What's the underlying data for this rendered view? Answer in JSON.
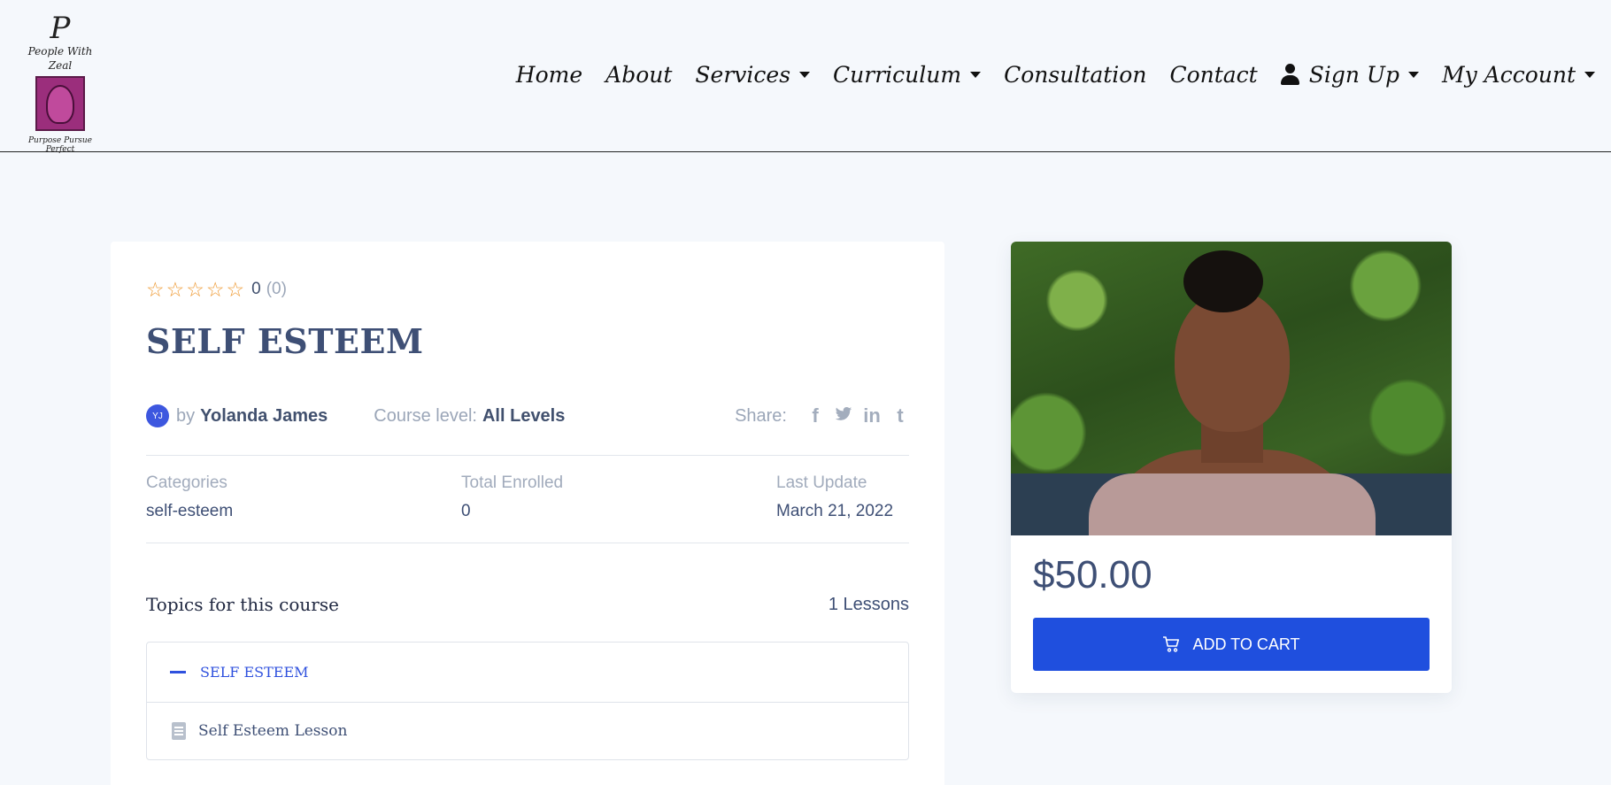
{
  "logo": {
    "monogram": "P",
    "brand": "People With Zeal",
    "tagline": "Purpose Pursue Perfect"
  },
  "nav": {
    "items": [
      {
        "label": "Home",
        "dropdown": false
      },
      {
        "label": "About",
        "dropdown": false
      },
      {
        "label": "Services",
        "dropdown": true
      },
      {
        "label": "Curriculum",
        "dropdown": true
      },
      {
        "label": "Consultation",
        "dropdown": false
      },
      {
        "label": "Contact",
        "dropdown": false
      },
      {
        "label": "Sign Up",
        "dropdown": true,
        "icon": "user-icon"
      },
      {
        "label": "My Account",
        "dropdown": true
      }
    ]
  },
  "course": {
    "rating": {
      "stars_filled": 0,
      "stars_total": 5,
      "score": "0",
      "count": "(0)"
    },
    "title": "SELF ESTEEM",
    "instructor": {
      "initials": "YJ",
      "by_label": "by",
      "name": "Yolanda James"
    },
    "level": {
      "label": "Course level:",
      "value": "All Levels"
    },
    "share": {
      "label": "Share:",
      "icons": [
        "facebook-icon",
        "twitter-icon",
        "linkedin-icon",
        "tumblr-icon"
      ]
    },
    "stats": {
      "categories": {
        "label": "Categories",
        "value": "self-esteem"
      },
      "enrolled": {
        "label": "Total Enrolled",
        "value": "0"
      },
      "updated": {
        "label": "Last Update",
        "value": "March 21, 2022"
      }
    },
    "topics": {
      "heading": "Topics for this course",
      "lesson_count": "1 Lessons",
      "items": [
        {
          "name": "SELF ESTEEM",
          "lessons": [
            "Self Esteem Lesson"
          ]
        }
      ]
    }
  },
  "sidebar": {
    "price": "$50.00",
    "add_to_cart": "ADD TO CART"
  },
  "colors": {
    "accent": "#1f4fde",
    "star": "#ee9a34",
    "heading": "#3e4f75",
    "muted": "#9ba6b8",
    "background": "#f5f8fc"
  }
}
